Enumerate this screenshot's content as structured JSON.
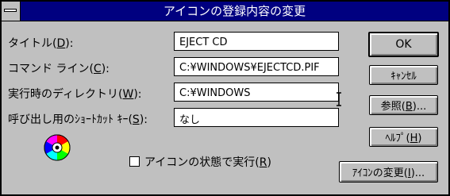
{
  "window": {
    "title": "アイコンの登録内容の変更"
  },
  "fields": {
    "title": {
      "label": "タイトル(",
      "mnemonic": "D",
      "suffix": "):",
      "value": "EJECT CD"
    },
    "command": {
      "label": "コマンド ライン(",
      "mnemonic": "C",
      "suffix": "):",
      "value": "C:¥WINDOWS¥EJECTCD.PIF"
    },
    "workdir": {
      "label": "実行時のディレクトリ(",
      "mnemonic": "W",
      "suffix": "):",
      "value": "C:¥WINDOWS"
    },
    "shortcut": {
      "label": "呼び出し用のｼｮｰﾄｶｯﾄ ｷｰ(",
      "mnemonic": "S",
      "suffix": "):",
      "value": "なし"
    }
  },
  "checkbox": {
    "label": "アイコンの状態で実行(",
    "mnemonic": "R",
    "suffix": ")",
    "checked": false
  },
  "buttons": {
    "ok": "OK",
    "cancel": "ｷｬﾝｾﾙ",
    "browse": {
      "label": "参照(",
      "mnemonic": "B",
      "suffix": ")..."
    },
    "help": {
      "label": "ﾍﾙﾌﾟ(",
      "mnemonic": "H",
      "suffix": ")"
    },
    "change_icon": {
      "label": "ｱｲｺﾝの変更(",
      "mnemonic": "I",
      "suffix": ")..."
    }
  },
  "icon": {
    "name": "cd-disc-icon",
    "colors": [
      "#ff0000",
      "#ffff00",
      "#00ff00",
      "#00ffff",
      "#0000ff",
      "#ff00ff"
    ]
  }
}
